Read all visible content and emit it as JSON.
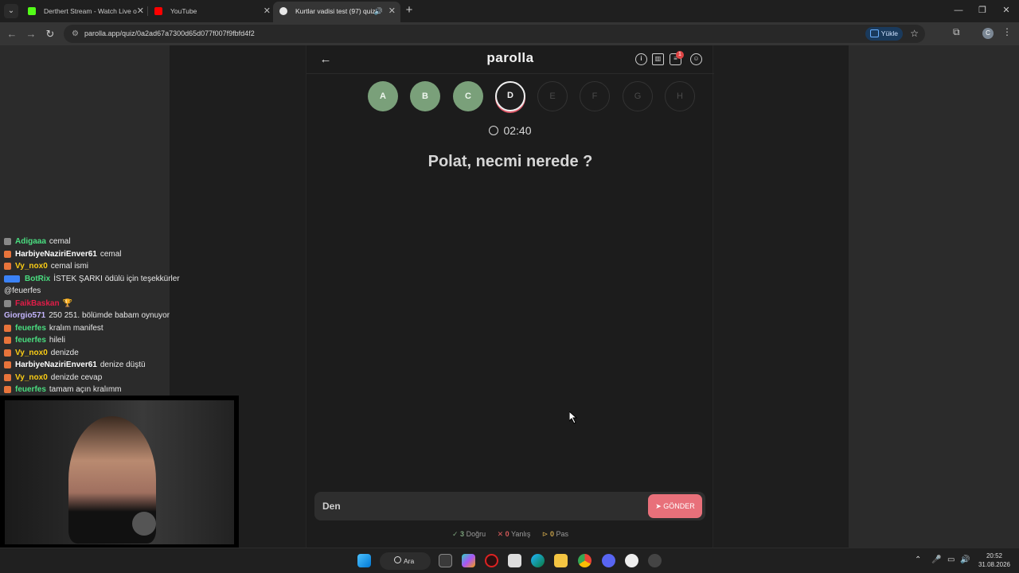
{
  "browser": {
    "tabs": [
      {
        "title": "Derthert Stream - Watch Live o",
        "fav_color": "#53fc18",
        "active": false
      },
      {
        "title": "YouTube",
        "fav_color": "#ff0000",
        "active": false
      },
      {
        "title": "Kurtlar vadisi test (97) quiz",
        "fav_color": "#e8e8e8",
        "active": true
      }
    ],
    "url": "parolla.app/quiz/0a2ad67a7300d65d077f007f9fbfd4f2",
    "upload_label": "Yükle",
    "profile_initial": "C"
  },
  "app": {
    "logo": "parolla",
    "notification_count": "1",
    "letters": [
      {
        "label": "A",
        "state": "done"
      },
      {
        "label": "B",
        "state": "done"
      },
      {
        "label": "C",
        "state": "done"
      },
      {
        "label": "D",
        "state": "current"
      },
      {
        "label": "E",
        "state": "todo"
      },
      {
        "label": "F",
        "state": "todo"
      },
      {
        "label": "G",
        "state": "todo"
      },
      {
        "label": "H",
        "state": "todo"
      }
    ],
    "timer": "02:40",
    "question": "Polat, necmi nerede ?",
    "answer_value": "Den",
    "send_label": "GÖNDER",
    "stats": {
      "correct": "3",
      "correct_label": "Doğru",
      "wrong": "0",
      "wrong_label": "Yanlış",
      "pass": "0",
      "pass_label": "Pas"
    }
  },
  "chat": [
    {
      "user": "Adigaaa",
      "color": "#4ade80",
      "msg": "cemal",
      "badge": "#888888"
    },
    {
      "user": "HarbiyeNaziriEnver61",
      "color": "#ffffff",
      "msg": "cemal",
      "badge": "#e8743b"
    },
    {
      "user": "Vy_nox0",
      "color": "#facc15",
      "msg": "cemal ismi",
      "badge": "#e8743b"
    },
    {
      "user": "BotRix",
      "color": "#4ade80",
      "msg": "İSTEK ŞARKI ödülü için teşekkürler",
      "cont": "@feuerfes",
      "badge": "#3b82f6"
    },
    {
      "user": "FaikBaskan",
      "color": "#e11d48",
      "msg": "🏆",
      "badge": "#888888"
    },
    {
      "user": "Giorgio571",
      "color": "#c4b5fd",
      "msg": "250 251. bölümde babam oynuyor",
      "badge": ""
    },
    {
      "user": "feuerfes",
      "color": "#4ade80",
      "msg": "kralım manifest",
      "badge": "#e8743b"
    },
    {
      "user": "feuerfes",
      "color": "#4ade80",
      "msg": "hileli",
      "badge": "#e8743b"
    },
    {
      "user": "Vy_nox0",
      "color": "#facc15",
      "msg": "denizde",
      "badge": "#e8743b"
    },
    {
      "user": "HarbiyeNaziriEnver61",
      "color": "#ffffff",
      "msg": "denize düştü",
      "badge": "#e8743b"
    },
    {
      "user": "Vy_nox0",
      "color": "#facc15",
      "msg": "denizde cevap",
      "badge": "#e8743b"
    },
    {
      "user": "feuerfes",
      "color": "#4ade80",
      "msg": "tamam açın kralımm",
      "badge": "#e8743b"
    }
  ],
  "taskbar": {
    "search_label": "Ara",
    "time": "20:52",
    "date": "31.08.2026"
  }
}
